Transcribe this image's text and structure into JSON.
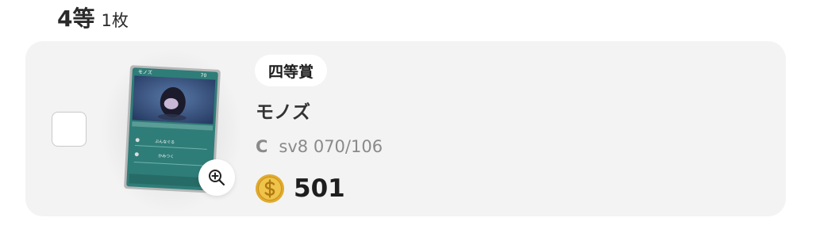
{
  "section": {
    "tier_title": "4等",
    "count_label": "1枚"
  },
  "prize": {
    "rank_badge": "四等賞",
    "card_name": "モノズ",
    "rarity": "C",
    "set_number": "sv8 070/106",
    "points": "501",
    "card_art": {
      "name_text": "モノズ",
      "hp_text": "70",
      "attack1": "ぶんなぐる",
      "attack2": "かみつく"
    }
  },
  "colors": {
    "row_background": "#f3f3f3",
    "coin_gold": "#e9b93a",
    "card_teal": "#2f7d78"
  },
  "icons": {
    "zoom": "zoom-in-icon",
    "coin": "coin-icon"
  }
}
